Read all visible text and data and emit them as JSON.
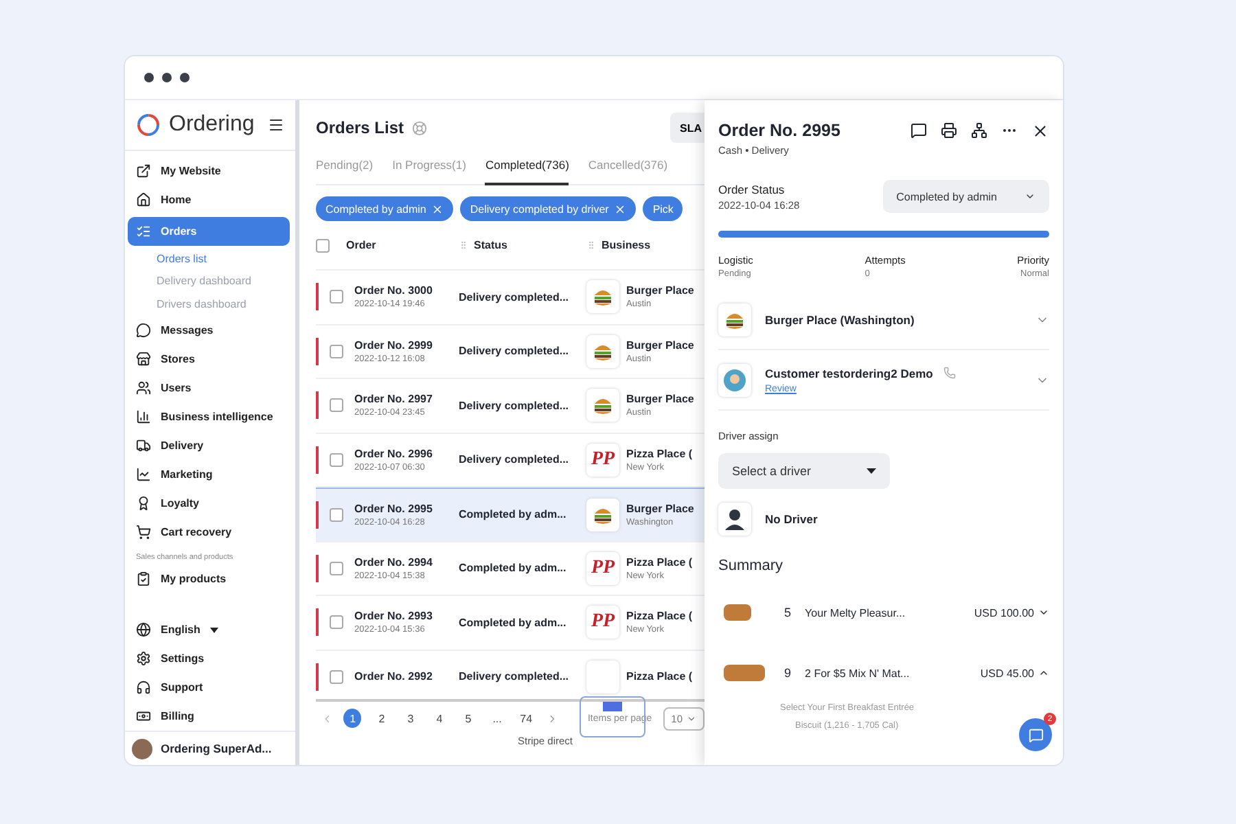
{
  "sidebar": {
    "brand": "Ordering",
    "items": [
      {
        "label": "My Website",
        "kind": "item",
        "selected": false
      },
      {
        "label": "Home",
        "kind": "item",
        "selected": false
      },
      {
        "label": "Orders",
        "kind": "item",
        "selected": true,
        "expanded": true,
        "children": [
          {
            "label": "Orders list",
            "selected": true
          },
          {
            "label": "Delivery dashboard",
            "selected": false
          },
          {
            "label": "Drivers dashboard",
            "selected": false
          }
        ]
      },
      {
        "label": "Messages",
        "kind": "item",
        "selected": false
      },
      {
        "label": "Stores",
        "kind": "item",
        "selected": false
      },
      {
        "label": "Users",
        "kind": "item",
        "selected": false
      },
      {
        "label": "Business intelligence",
        "kind": "item",
        "selected": false
      },
      {
        "label": "Delivery",
        "kind": "item",
        "selected": false
      },
      {
        "label": "Marketing",
        "kind": "item",
        "selected": false
      },
      {
        "label": "Loyalty",
        "kind": "item",
        "selected": false
      },
      {
        "label": "Cart recovery",
        "kind": "item",
        "selected": false
      },
      {
        "label": "Sales channels and products",
        "kind": "section"
      },
      {
        "label": "My products",
        "kind": "item",
        "selected": false
      }
    ],
    "bottom_items": [
      {
        "label": "English",
        "kind": "language"
      },
      {
        "label": "Settings",
        "kind": "item"
      },
      {
        "label": "Support",
        "kind": "item"
      },
      {
        "label": "Billing",
        "kind": "item"
      }
    ],
    "user": "Ordering SuperAd..."
  },
  "orders": {
    "title": "Orders List",
    "sla_button": "SLA",
    "tabs": [
      {
        "label": "Pending(2)",
        "selected": false
      },
      {
        "label": "In Progress(1)",
        "selected": false
      },
      {
        "label": "Completed(736)",
        "selected": true
      },
      {
        "label": "Cancelled(376)",
        "selected": false
      }
    ],
    "filters": [
      "Completed by admin",
      "Delivery completed by driver",
      "Pick"
    ],
    "columns": [
      "Order",
      "Status",
      "Business"
    ],
    "select_all": {
      "checked": false
    },
    "rows": [
      {
        "order": "Order No. 3000",
        "date": "2022-10-14 19:46",
        "status": "Delivery completed...",
        "business": "Burger Place",
        "city": "Austin",
        "kind": "burger",
        "selected": false
      },
      {
        "order": "Order No. 2999",
        "date": "2022-10-12 16:08",
        "status": "Delivery completed...",
        "business": "Burger Place",
        "city": "Austin",
        "kind": "burger",
        "selected": false
      },
      {
        "order": "Order No. 2997",
        "date": "2022-10-04 23:45",
        "status": "Delivery completed...",
        "business": "Burger Place",
        "city": "Austin",
        "kind": "burger",
        "selected": false
      },
      {
        "order": "Order No. 2996",
        "date": "2022-10-07 06:30",
        "status": "Delivery completed...",
        "business": "Pizza Place (",
        "city": "New York",
        "kind": "pizza",
        "logo_text": "PP",
        "selected": false
      },
      {
        "order": "Order No. 2995",
        "date": "2022-10-04 16:28",
        "status": "Completed by adm...",
        "business": "Burger Place",
        "city": "Washington",
        "kind": "burger",
        "selected": true
      },
      {
        "order": "Order No. 2994",
        "date": "2022-10-04 15:38",
        "status": "Completed by adm...",
        "business": "Pizza Place (",
        "city": "New York",
        "kind": "pizza",
        "logo_text": "PP",
        "selected": false
      },
      {
        "order": "Order No. 2993",
        "date": "2022-10-04 15:36",
        "status": "Completed by adm...",
        "business": "Pizza Place (",
        "city": "New York",
        "kind": "pizza",
        "logo_text": "PP",
        "selected": false
      },
      {
        "order": "Order No. 2992",
        "status": "Delivery completed...",
        "business": "Pizza Place (",
        "kind": "pizza",
        "selected": false
      }
    ],
    "pagination": {
      "pages": [
        {
          "label": "1",
          "selected": true
        },
        {
          "label": "2",
          "selected": false
        },
        {
          "label": "3",
          "selected": false
        },
        {
          "label": "4",
          "selected": false
        },
        {
          "label": "5",
          "selected": false
        },
        {
          "label": "...",
          "selected": false
        },
        {
          "label": "74",
          "selected": false
        }
      ],
      "items_per_page_label": "Items per page",
      "items_per_page": "10",
      "footer": "Stripe direct"
    }
  },
  "detail": {
    "title": "Order No. 2995",
    "subtitle": "Cash • Delivery",
    "status_label": "Order Status",
    "status_date": "2022-10-04 16:28",
    "status_value": "Completed by admin",
    "progress": {
      "level": 1
    },
    "stats": [
      {
        "label": "Logistic",
        "value": "Pending"
      },
      {
        "label": "Attempts",
        "value": "0"
      },
      {
        "label": "Priority",
        "value": "Normal"
      }
    ],
    "business": "Burger Place (Washington)",
    "customer": "Customer testordering2 Demo",
    "review_link": "Review",
    "driver_label": "Driver assign",
    "driver_select": "Select a driver",
    "driver_name": "No Driver",
    "summary_title": "Summary",
    "products": [
      {
        "qty": "5",
        "name": "Your Melty Pleasur...",
        "price": "USD 100.00",
        "expanded": false
      },
      {
        "qty": "9",
        "name": "2 For $5 Mix N' Mat...",
        "price": "USD 45.00",
        "expanded": true,
        "options": [
          "Select Your First Breakfast Entrée",
          "Biscuit (1,216 - 1,705 Cal)"
        ]
      }
    ],
    "chat_badge": "2"
  }
}
